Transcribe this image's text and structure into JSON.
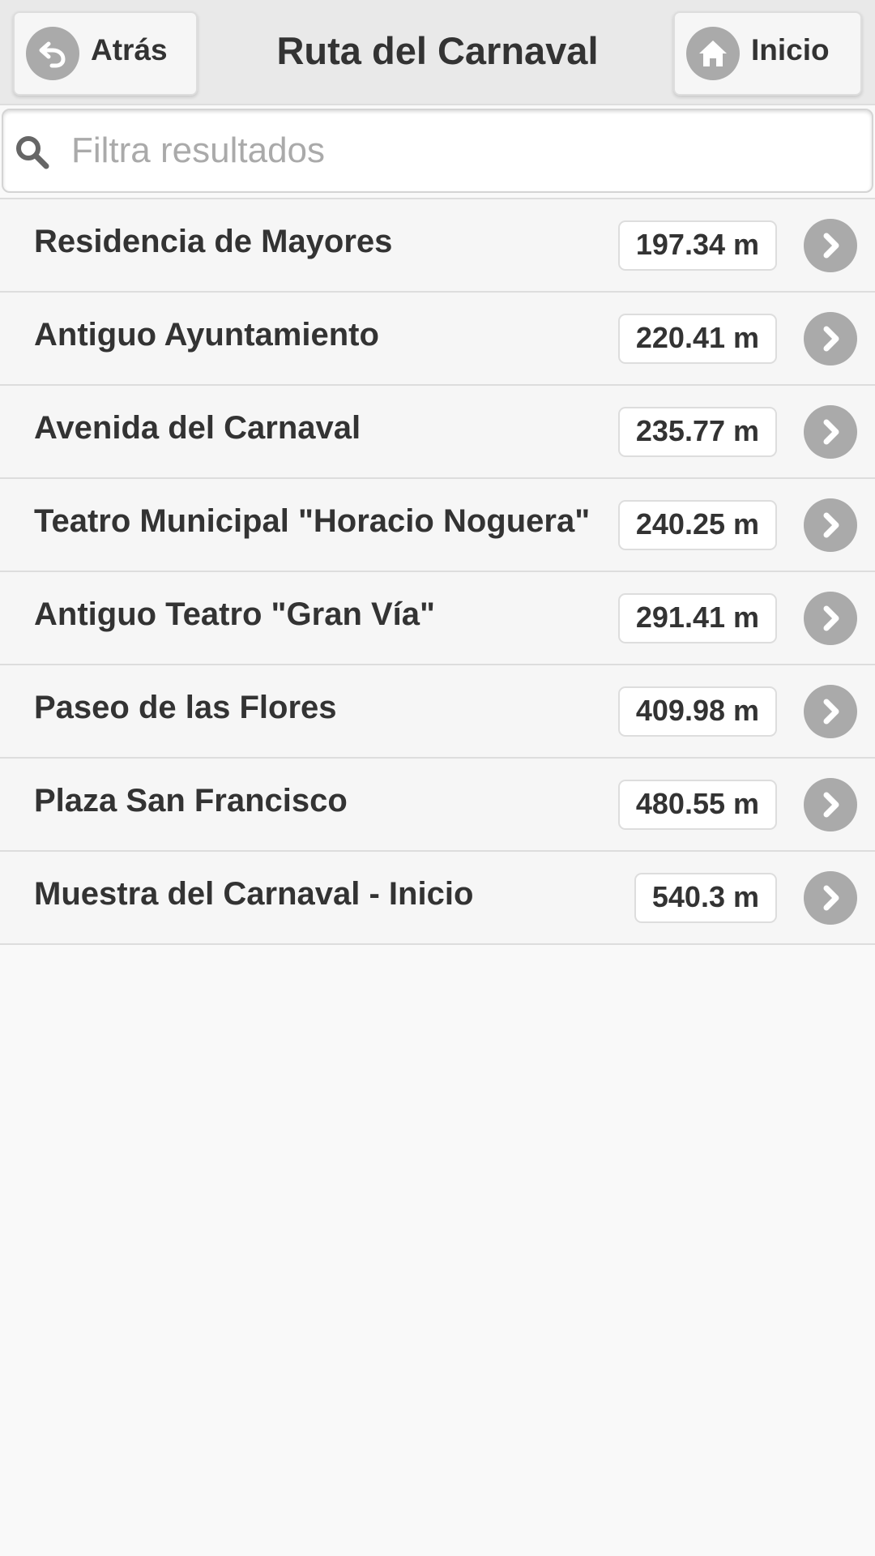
{
  "header": {
    "title": "Ruta del Carnaval",
    "back_label": "Atrás",
    "home_label": "Inicio"
  },
  "search": {
    "placeholder": "Filtra resultados",
    "value": ""
  },
  "list": {
    "items": [
      {
        "name": "Residencia de Mayores",
        "distance": "197.34 m"
      },
      {
        "name": "Antiguo Ayuntamiento",
        "distance": "220.41 m"
      },
      {
        "name": "Avenida del Carnaval",
        "distance": "235.77 m"
      },
      {
        "name": "Teatro Municipal \"Horacio Noguera\"",
        "distance": "240.25 m"
      },
      {
        "name": "Antiguo Teatro \"Gran Vía\"",
        "distance": "291.41 m"
      },
      {
        "name": "Paseo de las Flores",
        "distance": "409.98 m"
      },
      {
        "name": "Plaza San Francisco",
        "distance": "480.55 m"
      },
      {
        "name": "Muestra del Carnaval - Inicio",
        "distance": "540.3 m"
      }
    ]
  },
  "icons": {
    "back": "back-arrow-icon",
    "home": "home-icon",
    "search": "search-icon",
    "row_arrow": "chevron-right-icon"
  },
  "colors": {
    "header_background": "#e9e9e9",
    "icon_disc": "#aaaaaa",
    "text": "#333333",
    "placeholder": "#aaaaaa",
    "list_background": "#f6f6f6",
    "page_background": "#f9f9f9"
  }
}
